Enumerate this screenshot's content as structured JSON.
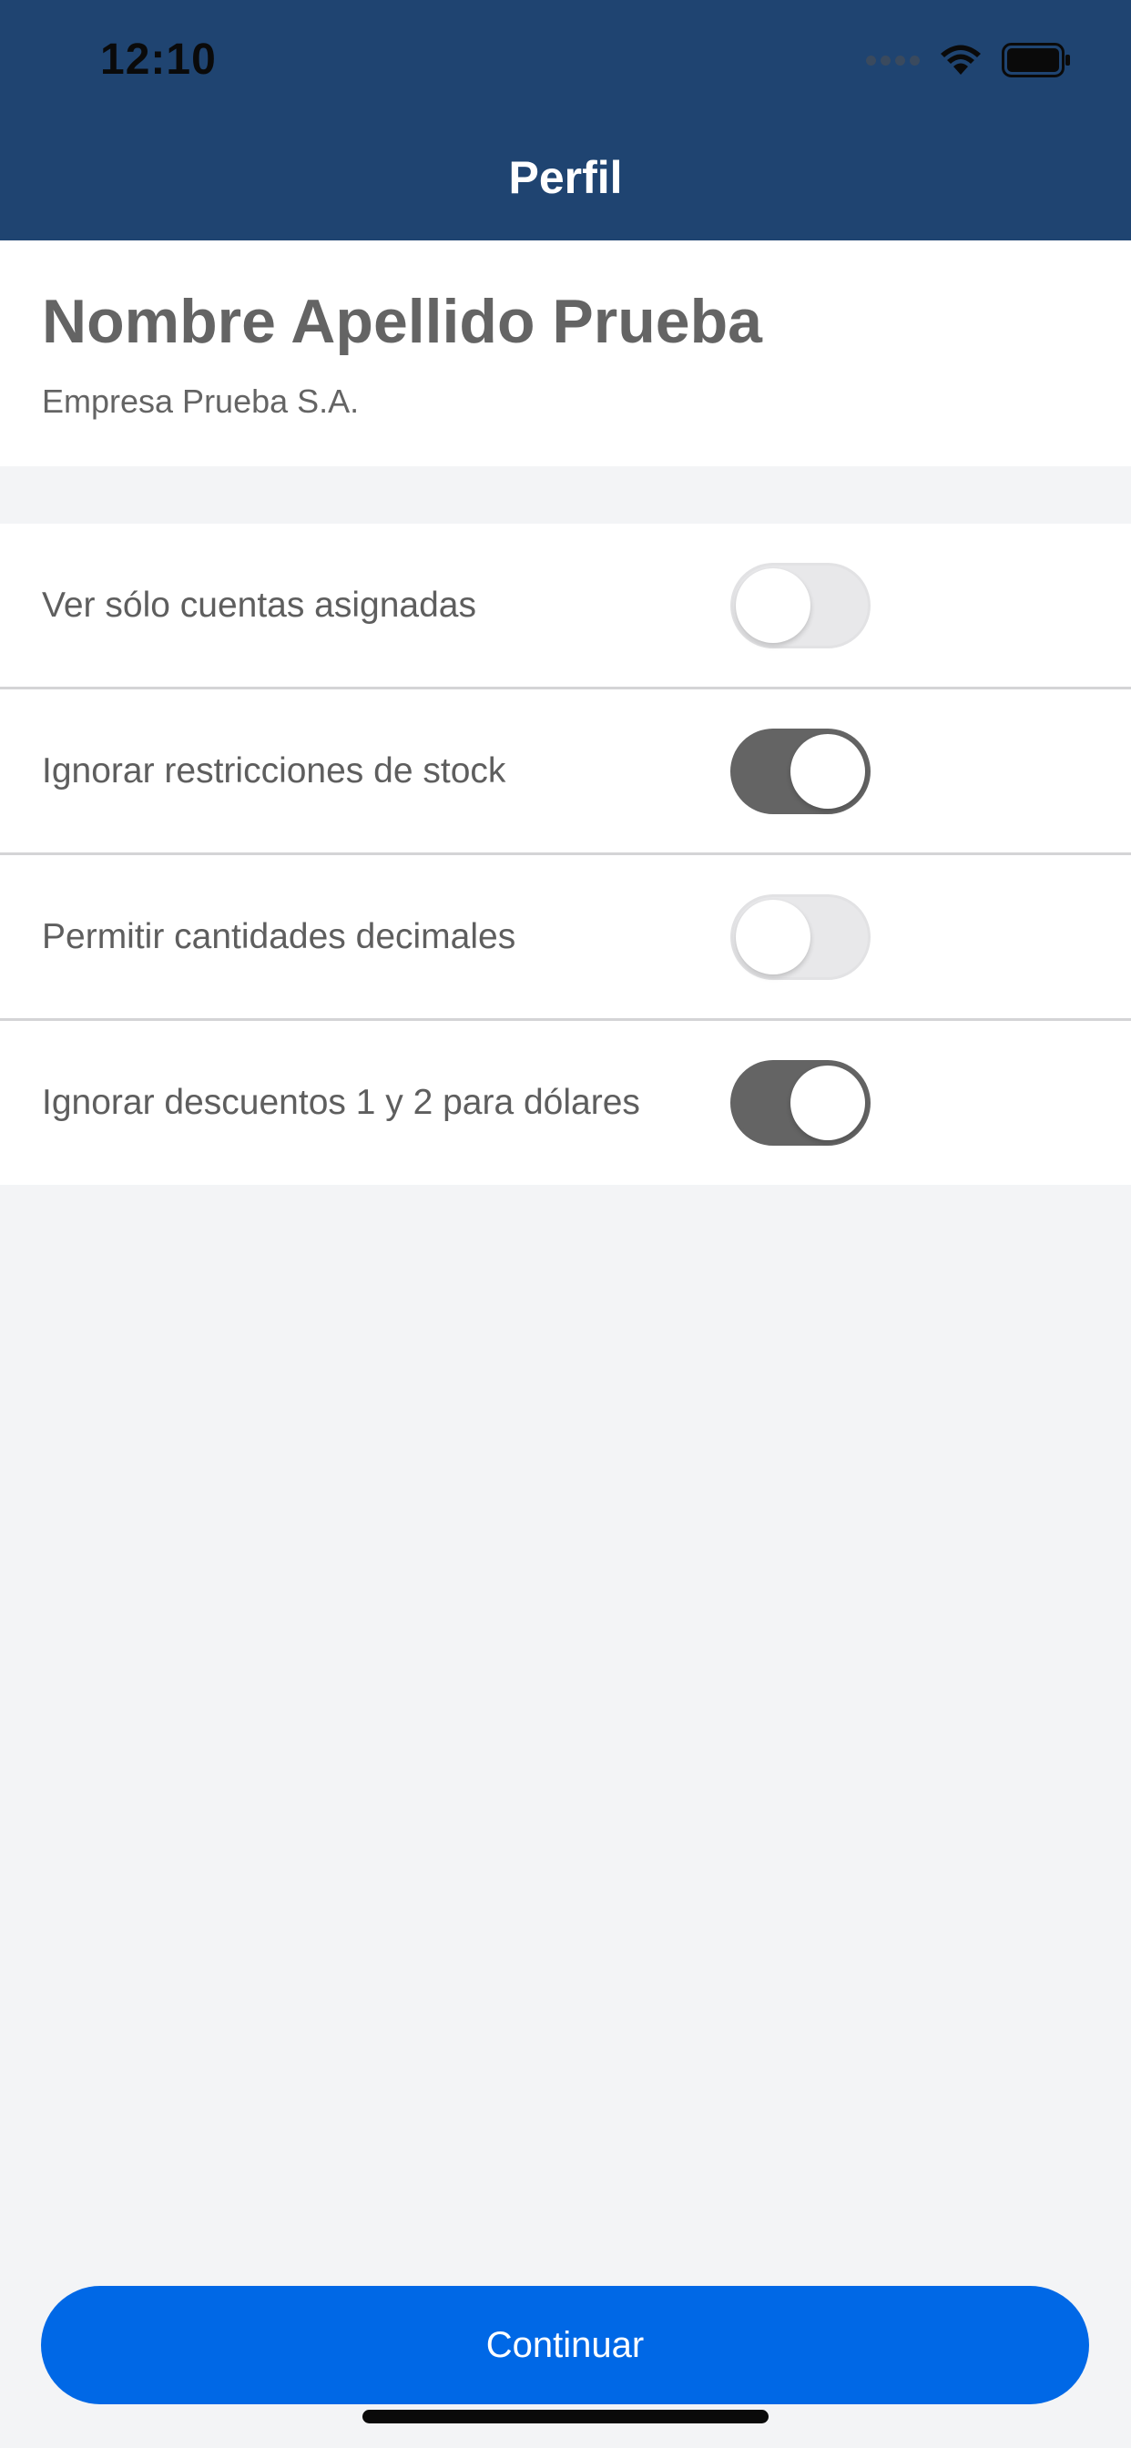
{
  "status_bar": {
    "time": "12:10"
  },
  "header": {
    "title": "Perfil",
    "background_color": "#1F4471"
  },
  "profile": {
    "name": "Nombre Apellido Prueba",
    "company": "Empresa Prueba S.A."
  },
  "settings": {
    "items": [
      {
        "label": "Ver sólo cuentas asignadas",
        "enabled": false
      },
      {
        "label": "Ignorar restricciones de stock",
        "enabled": true
      },
      {
        "label": "Permitir cantidades decimales",
        "enabled": false
      },
      {
        "label": "Ignorar descuentos 1 y 2 para dólares",
        "enabled": true
      }
    ]
  },
  "footer": {
    "continue_label": "Continuar",
    "button_color": "#0068E6"
  },
  "icons": {
    "signal": "cellular-signal-icon",
    "wifi": "wifi-icon",
    "battery": "battery-icon"
  }
}
